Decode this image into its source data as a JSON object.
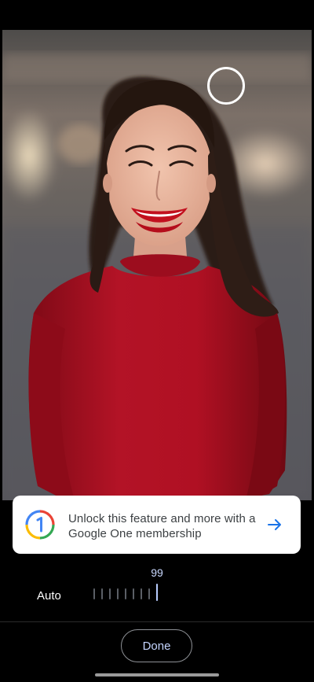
{
  "photo": {
    "subject": "portrait-photo",
    "accent_colors": {
      "dress": "#b01023",
      "hair": "#2a1a14",
      "skin": "#e8b7a0",
      "background": "#5b5a5c"
    }
  },
  "upsell": {
    "text": "Unlock this feature and more with a Google One membership",
    "logo": "google-one-icon",
    "action_icon": "arrow-right-icon",
    "accent": "#1a73e8"
  },
  "slider": {
    "label": "Auto",
    "value": "99",
    "level_percent": 99
  },
  "footer": {
    "done_label": "Done"
  }
}
